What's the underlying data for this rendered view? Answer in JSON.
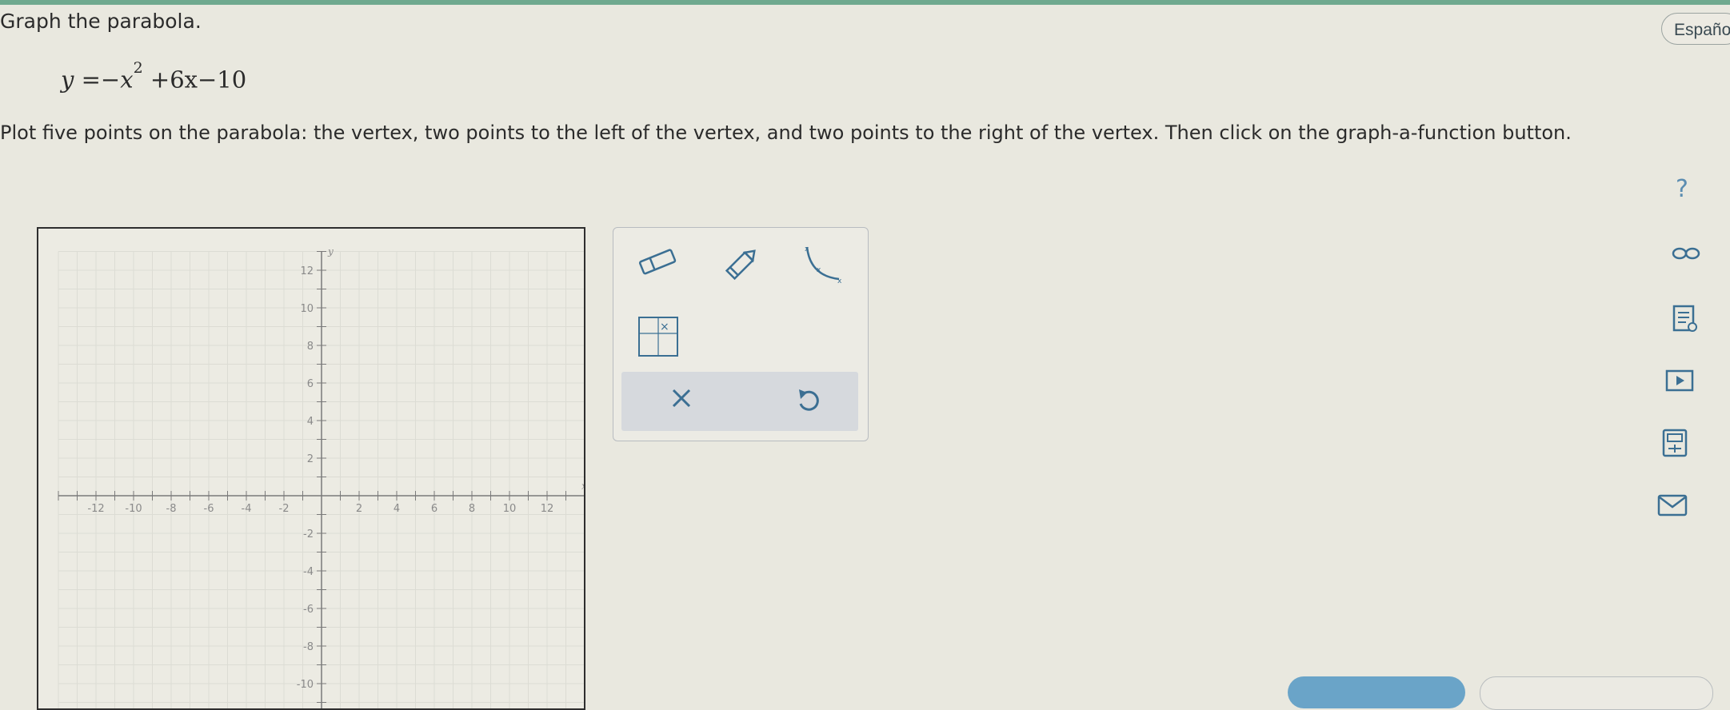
{
  "header": {
    "title": "Graph the parabola.",
    "language_button": "Español"
  },
  "problem": {
    "eq_lhs": "y",
    "eq_eq": "=",
    "eq_neg": "−",
    "eq_x": "x",
    "eq_exp": "2",
    "eq_rest": "+6x−10",
    "instructions": "Plot five points on the parabola: the vertex, two points to the left of the vertex, and two points to the right of the vertex. Then click on the graph-a-function button."
  },
  "graph": {
    "x_axis_label": "x",
    "y_axis_label": "y",
    "x_ticks": [
      "-12",
      "-10",
      "-8",
      "-6",
      "-4",
      "-2",
      "2",
      "4",
      "6",
      "8",
      "10",
      "12"
    ],
    "y_ticks": [
      "12",
      "10",
      "8",
      "6",
      "4",
      "2",
      "-2",
      "-4",
      "-6",
      "-8",
      "-10"
    ],
    "x_range": [
      -14,
      14
    ],
    "y_range": [
      -12,
      13
    ]
  },
  "tools": {
    "eraser": "eraser-icon",
    "pencil": "pencil-icon",
    "graph_function": "graph-function-icon",
    "point_grid": "point-grid-icon",
    "clear": "close-icon",
    "undo": "undo-icon"
  },
  "sidebar": {
    "icons": [
      "question-icon",
      "infinity-icon",
      "textbook-icon",
      "video-icon",
      "calculator-icon",
      "mail-icon"
    ],
    "question_glyph": "?",
    "accent": "#3d7fa6"
  },
  "colors": {
    "accent": "#3d7fa6",
    "bar": "#6fa98f"
  }
}
